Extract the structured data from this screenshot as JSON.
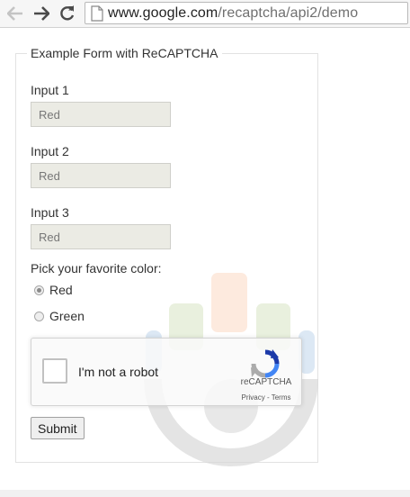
{
  "browser": {
    "url_domain": "www.google.com",
    "url_path": "/recaptcha/api2/demo"
  },
  "form": {
    "legend": "Example Form with ReCAPTCHA",
    "inputs": [
      {
        "label": "Input 1",
        "value": "Red"
      },
      {
        "label": "Input 2",
        "value": "Red"
      },
      {
        "label": "Input 3",
        "value": "Red"
      }
    ],
    "color_question": "Pick your favorite color:",
    "color_options": [
      {
        "label": "Red",
        "checked": true
      },
      {
        "label": "Green",
        "checked": false
      }
    ],
    "submit_label": "Submit"
  },
  "recaptcha": {
    "checkbox_label": "I'm not a robot",
    "brand": "reCAPTCHA",
    "privacy_link": "Privacy",
    "separator": " - ",
    "terms_link": "Terms"
  },
  "icons": {
    "back": "arrow-left-icon",
    "forward": "arrow-right-icon",
    "reload": "reload-icon",
    "page": "page-icon",
    "recaptcha_logo": "recaptcha-logo-icon"
  },
  "colors": {
    "input_bg": "#ebebe4",
    "watermark_blue": "#3b7fc4",
    "watermark_orange": "#f4a06a",
    "watermark_green": "#8fb35a"
  }
}
